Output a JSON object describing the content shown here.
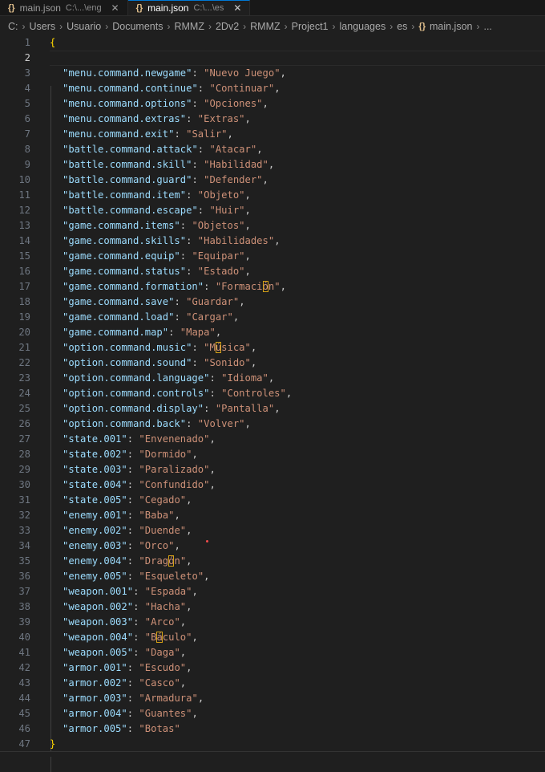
{
  "tabs": [
    {
      "label": "main.json",
      "path": "C:\\...\\eng",
      "active": false
    },
    {
      "label": "main.json",
      "path": "C:\\...\\es",
      "active": true
    }
  ],
  "tab_close_glyph": "✕",
  "breadcrumb": [
    "C:",
    "Users",
    "Usuario",
    "Documents",
    "RMMZ",
    "2Dv2",
    "RMMZ",
    "Project1",
    "languages",
    "es",
    "main.json",
    "..."
  ],
  "editor": {
    "line_count": 47,
    "current_line": 2,
    "open_brace": "{",
    "close_brace": "}",
    "entries": [
      {
        "key": "menu.command.newgame",
        "value": "Nuevo Juego"
      },
      {
        "key": "menu.command.continue",
        "value": "Continuar"
      },
      {
        "key": "menu.command.options",
        "value": "Opciones"
      },
      {
        "key": "menu.command.extras",
        "value": "Extras"
      },
      {
        "key": "menu.command.exit",
        "value": "Salir"
      },
      {
        "key": "battle.command.attack",
        "value": "Atacar"
      },
      {
        "key": "battle.command.skill",
        "value": "Habilidad"
      },
      {
        "key": "battle.command.guard",
        "value": "Defender"
      },
      {
        "key": "battle.command.item",
        "value": "Objeto"
      },
      {
        "key": "battle.command.escape",
        "value": "Huir"
      },
      {
        "key": "game.command.items",
        "value": "Objetos"
      },
      {
        "key": "game.command.skills",
        "value": "Habilidades"
      },
      {
        "key": "game.command.equip",
        "value": "Equipar"
      },
      {
        "key": "game.command.status",
        "value": "Estado"
      },
      {
        "key": "game.command.formation",
        "value": "Formación",
        "hl": 7
      },
      {
        "key": "game.command.save",
        "value": "Guardar"
      },
      {
        "key": "game.command.load",
        "value": "Cargar"
      },
      {
        "key": "game.command.map",
        "value": "Mapa"
      },
      {
        "key": "option.command.music",
        "value": "Música",
        "hl": 1
      },
      {
        "key": "option.command.sound",
        "value": "Sonido"
      },
      {
        "key": "option.command.language",
        "value": "Idioma"
      },
      {
        "key": "option.command.controls",
        "value": "Controles"
      },
      {
        "key": "option.command.display",
        "value": "Pantalla"
      },
      {
        "key": "option.command.back",
        "value": "Volver"
      },
      {
        "key": "state.001",
        "value": "Envenenado"
      },
      {
        "key": "state.002",
        "value": "Dormido"
      },
      {
        "key": "state.003",
        "value": "Paralizado"
      },
      {
        "key": "state.004",
        "value": "Confundido"
      },
      {
        "key": "state.005",
        "value": "Cegado"
      },
      {
        "key": "enemy.001",
        "value": "Baba"
      },
      {
        "key": "enemy.002",
        "value": "Duende"
      },
      {
        "key": "enemy.003",
        "value": "Orco"
      },
      {
        "key": "enemy.004",
        "value": "Dragón",
        "hl": 4
      },
      {
        "key": "enemy.005",
        "value": "Esqueleto"
      },
      {
        "key": "weapon.001",
        "value": "Espada"
      },
      {
        "key": "weapon.002",
        "value": "Hacha"
      },
      {
        "key": "weapon.003",
        "value": "Arco"
      },
      {
        "key": "weapon.004",
        "value": "Báculo",
        "hl": 1
      },
      {
        "key": "weapon.005",
        "value": "Daga"
      },
      {
        "key": "armor.001",
        "value": "Escudo"
      },
      {
        "key": "armor.002",
        "value": "Casco"
      },
      {
        "key": "armor.003",
        "value": "Armadura"
      },
      {
        "key": "armor.004",
        "value": "Guantes"
      },
      {
        "key": "armor.005",
        "value": "Botas"
      }
    ]
  },
  "colors": {
    "key": "#9cdcfe",
    "string": "#ce9178",
    "brace": "#ffd700",
    "background": "#1f1f1f",
    "line_number": "#6e7681"
  }
}
